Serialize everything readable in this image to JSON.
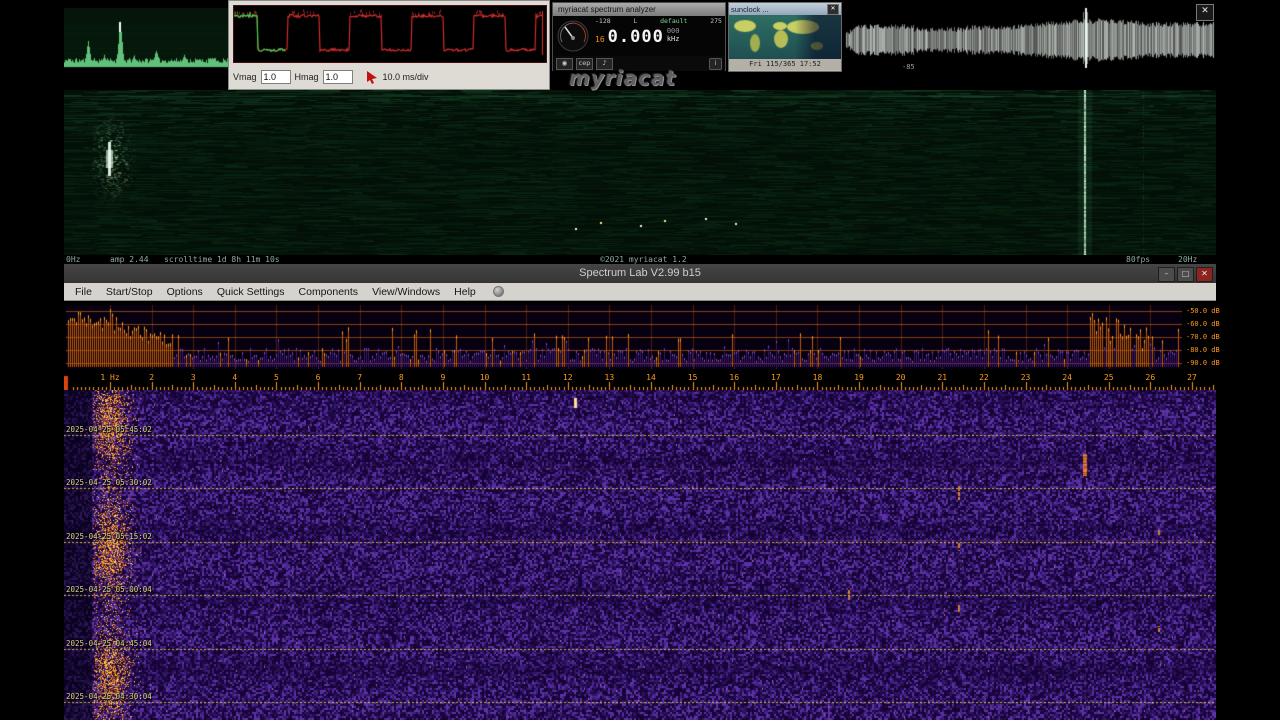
{
  "myriacat": {
    "window_close": "✕",
    "scope": {
      "vmag_label": "Vmag",
      "vmag_value": "1.0",
      "hmag_label": "Hmag",
      "hmag_value": "1.0",
      "timebase": "10.0 ms/div"
    },
    "analyzer": {
      "title": "myriacat spectrum analyzer",
      "level": "-128",
      "channel": "L",
      "preset": "default",
      "aux": "275",
      "gain": "16",
      "freq": "0.000",
      "freq_frac": "000",
      "freq_unit": "kHz",
      "power_button": "◉",
      "cep_button": "cep",
      "audio_button": "♪",
      "info_button": "i"
    },
    "logo": "myriacat",
    "sunclock": {
      "title": "sunclock ...",
      "close": "✕",
      "status": "Fri 115/365 17:52"
    },
    "envelope_marker": "-85",
    "status": {
      "freq_left": "0Hz",
      "amp": "amp 2.44",
      "scrolltime": "scrolltime 1d 8h 11m 10s",
      "copyright": "©2021 myriacat 1.2",
      "fps": "80fps",
      "freq_right": "20Hz"
    }
  },
  "spectrumlab": {
    "title": "Spectrum Lab V2.99 b15",
    "window_buttons": {
      "minimize": "–",
      "maximize": "□",
      "close": "✕"
    },
    "menus": [
      "File",
      "Start/Stop",
      "Options",
      "Quick Settings",
      "Components",
      "View/Windows",
      "Help"
    ],
    "db_labels": [
      "-50.0 dB",
      "-60.0 dB",
      "-70.0 dB",
      "-80.0 dB",
      "-90.0 dB"
    ],
    "freq_labels": [
      "1 Hz",
      "2",
      "3",
      "4",
      "5",
      "6",
      "7",
      "8",
      "9",
      "10",
      "11",
      "12",
      "13",
      "14",
      "15",
      "16",
      "17",
      "18",
      "19",
      "20",
      "21",
      "22",
      "23",
      "24",
      "25",
      "26",
      "27"
    ],
    "timestamps": [
      "2025-04-25 05:45:02",
      "2025-04-25 05:30:02",
      "2025-04-25 05:15:02",
      "2025-04-25 05:00:04",
      "2025-04-25 04:45:04",
      "2025-04-25 04:30:04"
    ]
  }
}
